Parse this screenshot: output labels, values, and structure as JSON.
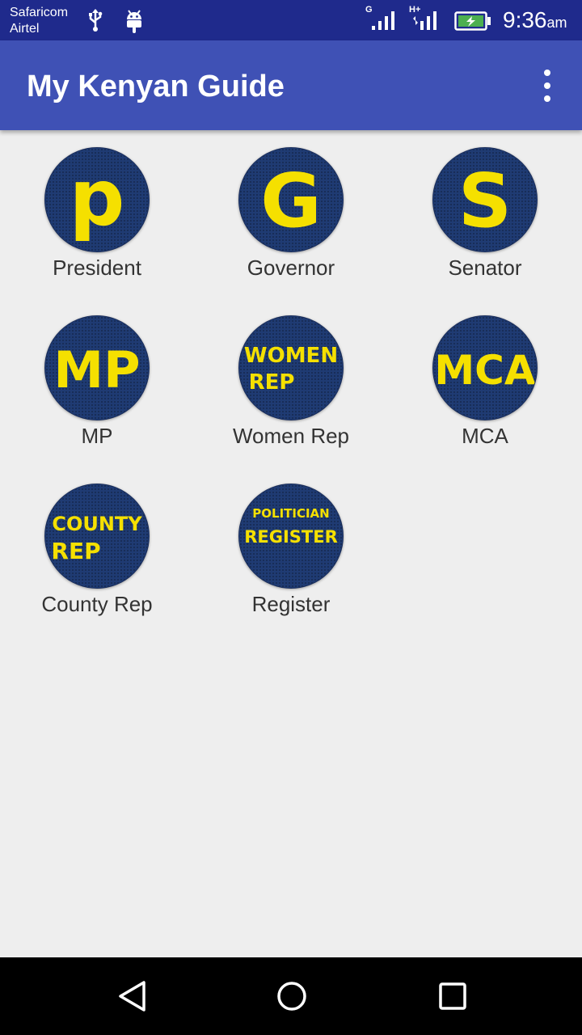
{
  "status_bar": {
    "carrier_1": "Safaricom",
    "carrier_2": "Airtel",
    "signal_1_type": "G",
    "signal_2_type": "H+",
    "time": "9:36",
    "time_suffix": "am",
    "icons": [
      "usb-icon",
      "android-debug-icon",
      "signal-icon",
      "signal-icon",
      "battery-charging-icon"
    ]
  },
  "app_bar": {
    "title": "My Kenyan Guide",
    "menu_icon": "overflow-menu-icon"
  },
  "tiles": [
    {
      "label": "President",
      "badge": "p"
    },
    {
      "label": "Governor",
      "badge": "G"
    },
    {
      "label": "Senator",
      "badge": "S"
    },
    {
      "label": "MP",
      "badge": "MP"
    },
    {
      "label": "Women Rep",
      "badge_line_1": "WOMEN",
      "badge_line_2": "REP"
    },
    {
      "label": "MCA",
      "badge": "MCA"
    },
    {
      "label": "County Rep",
      "badge_line_1": "COUNTY",
      "badge_line_2": "REP"
    },
    {
      "label": "Register",
      "badge_line_1": "POLITICIAN",
      "badge_line_2": "REGISTER"
    }
  ],
  "colors": {
    "status_bar": "#1f2a8c",
    "app_bar": "#3f51b5",
    "badge_bg": "#1f3b73",
    "badge_text": "#f5e000",
    "page_bg": "#eeeeee"
  },
  "nav_bar": {
    "buttons": [
      "back-icon",
      "home-icon",
      "recents-icon"
    ]
  }
}
